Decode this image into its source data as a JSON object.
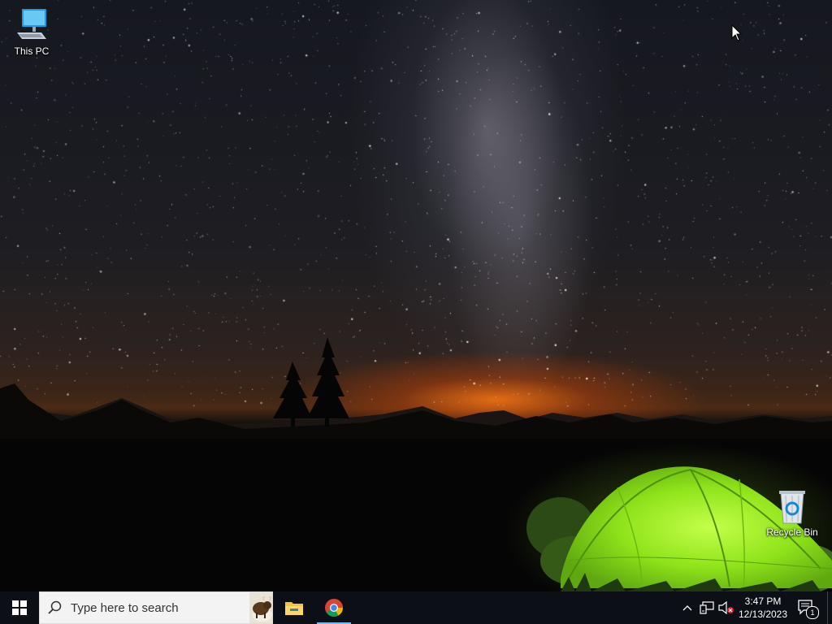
{
  "desktop": {
    "icons": [
      {
        "label": "This PC",
        "icon": "this-pc-icon"
      },
      {
        "label": "Recycle Bin",
        "icon": "recycle-bin-icon"
      }
    ]
  },
  "taskbar": {
    "start_icon": "windows-logo-icon",
    "search": {
      "placeholder": "Type here to search",
      "value": ""
    },
    "pinned": [
      {
        "name": "File Explorer",
        "icon": "file-explorer-icon"
      },
      {
        "name": "Google Chrome",
        "icon": "chrome-icon",
        "active": true
      }
    ],
    "tray": {
      "icons": [
        "chevron-up-icon",
        "network-icon",
        "volume-muted-icon"
      ],
      "time": "3:47 PM",
      "date": "12/13/2023",
      "notification_count": "1"
    }
  },
  "colors": {
    "taskbar_bg": "#0c1016",
    "search_bg": "#f3f3f3",
    "accent_active": "#76b9ed",
    "tent_green": "#8fe31a",
    "horizon_glow": "#ff7a14"
  }
}
